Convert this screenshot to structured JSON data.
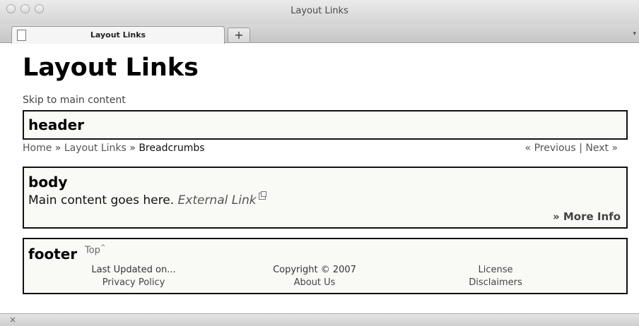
{
  "window": {
    "title": "Layout Links",
    "tab_label": "Layout Links",
    "new_tab_symbol": "+",
    "tab_menu_symbol": "▾",
    "status_close_symbol": "×"
  },
  "page": {
    "title": "Layout Links",
    "skip_link": "Skip to main content",
    "header_label": "header",
    "breadcrumb": {
      "home": "Home",
      "section": "Layout Links",
      "current": "Breadcrumbs",
      "separator": "»"
    },
    "pager": {
      "previous": "« Previous",
      "separator": "|",
      "next": "Next »"
    },
    "body": {
      "label": "body",
      "text": "Main content goes here.",
      "external_link": "External Link",
      "more_info": "» More Info"
    },
    "footer": {
      "label": "footer",
      "top_link": "Top",
      "top_marker": "^",
      "col1": {
        "line1": "Last Updated on...",
        "line2": "Privacy Policy"
      },
      "col2": {
        "line1": "Copyright © 2007",
        "line2": "About Us"
      },
      "col3": {
        "line1": "License",
        "line2": "Disclaimers"
      }
    }
  },
  "icons": [
    "page-icon",
    "external-link-icon",
    "close-icon"
  ]
}
